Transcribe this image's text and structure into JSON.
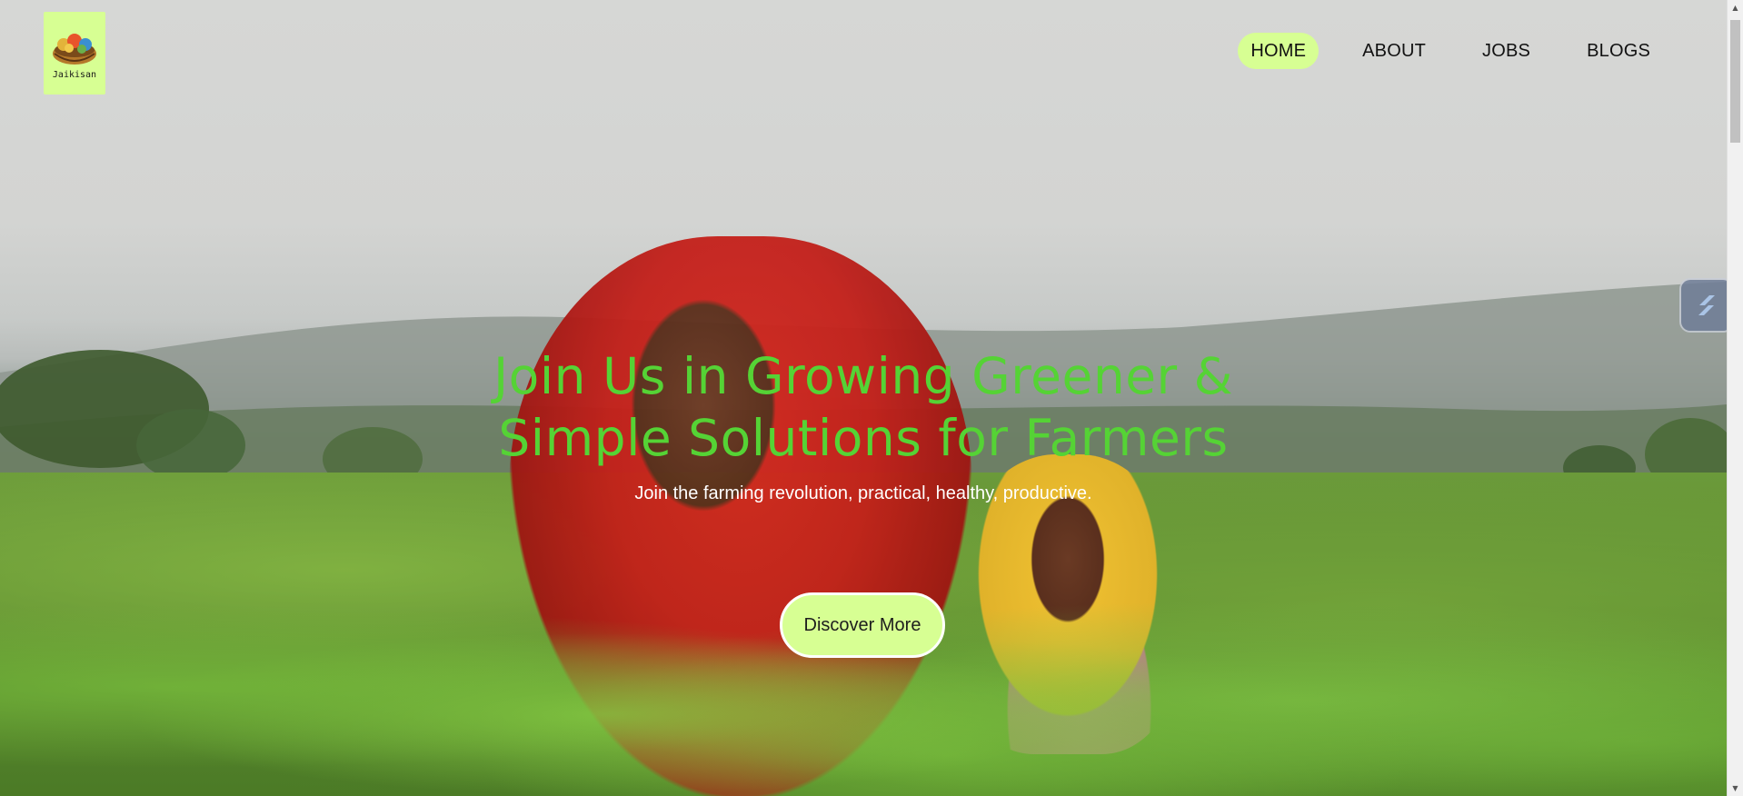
{
  "brand": {
    "name": "Jaikisan",
    "logo_icon": "harvest-basket-icon",
    "accent_color": "#d7ff93"
  },
  "nav": {
    "items": [
      {
        "label": "HOME",
        "active": true
      },
      {
        "label": "ABOUT",
        "active": false
      },
      {
        "label": "JOBS",
        "active": false
      },
      {
        "label": "BLOGS",
        "active": false
      }
    ]
  },
  "hero": {
    "title": "Join Us in Growing Greener & Simple Solutions for Farmers",
    "subtitle": "Join the farming revolution, practical, healthy, productive.",
    "cta_label": "Discover More",
    "title_color": "#55d335"
  },
  "widget": {
    "icon": "layers-icon"
  }
}
